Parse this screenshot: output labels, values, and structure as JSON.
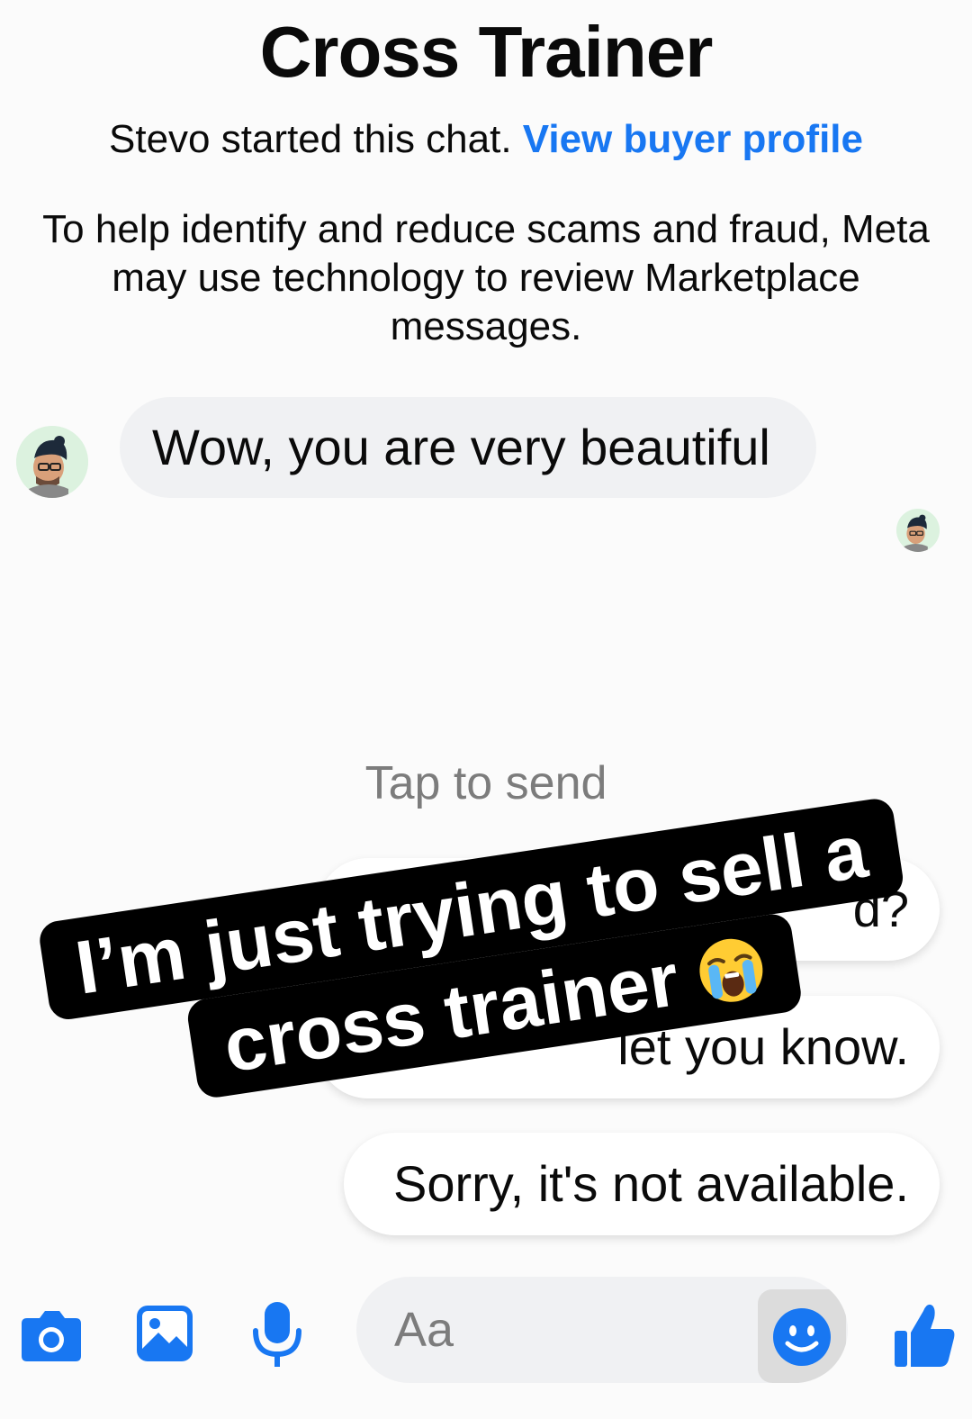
{
  "header": {
    "title": "Cross Trainer",
    "started_text": "Stevo started this chat.",
    "profile_link": "View buyer profile"
  },
  "notice": "To help identify and reduce scams and fraud, Meta may use technology to review Marketplace messages.",
  "messages": [
    {
      "from": "buyer",
      "text": "Wow, you are very beautiful"
    }
  ],
  "quick_replies": {
    "hint": "Tap to send",
    "items": [
      {
        "label": "d?"
      },
      {
        "label": "let you know."
      },
      {
        "label": "Sorry, it's not available."
      }
    ]
  },
  "overlay_caption": {
    "line1": "I’m just trying to sell a",
    "line2": "cross trainer"
  },
  "composer": {
    "placeholder": "Aa"
  },
  "colors": {
    "accent": "#1877f2",
    "bubble": "#f0f1f3",
    "hint_text": "#7c7c7c"
  },
  "icons": [
    "camera-icon",
    "gallery-icon",
    "microphone-icon",
    "smiley-icon",
    "thumbs-up-icon",
    "loudly-crying-face-emoji"
  ]
}
